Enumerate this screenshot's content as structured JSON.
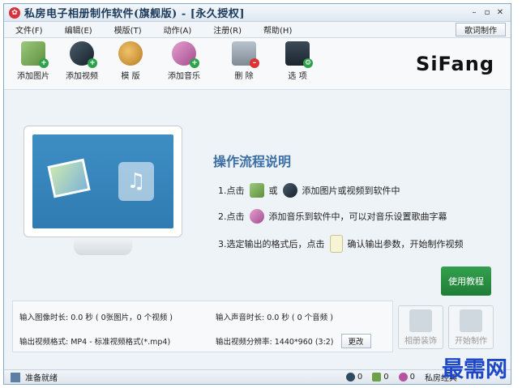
{
  "window": {
    "title": "私房电子相册制作软件(旗舰版) - [永久授权]",
    "controls": [
      "–",
      "▫",
      "✕"
    ]
  },
  "menu": {
    "items": [
      "文件(F)",
      "编辑(E)",
      "模版(T)",
      "动作(A)",
      "注册(R)",
      "帮助(H)"
    ],
    "lyric_button": "歌词制作"
  },
  "toolbar": {
    "items": [
      {
        "label": "添加图片",
        "icon": "add-picture-icon"
      },
      {
        "label": "添加视频",
        "icon": "add-video-icon"
      },
      {
        "label": "模 版",
        "icon": "template-palette-icon"
      },
      {
        "label": "添加音乐",
        "icon": "add-music-icon"
      },
      {
        "label": "删 除",
        "icon": "delete-trash-icon"
      },
      {
        "label": "选 项",
        "icon": "options-icon"
      }
    ],
    "logo": "SiFang"
  },
  "main": {
    "flow_title": "操作流程说明",
    "step1_prefix": "1.点击",
    "step1_or": "或",
    "step1_suffix": "添加图片或视频到软件中",
    "step2_prefix": "2.点击",
    "step2_suffix": "添加音乐到软件中，可以对音乐设置歌曲字幕",
    "step3_prefix": "3.选定输出的格式后，点击",
    "step3_suffix": "确认输出参数，开始制作视频",
    "tutorial_button": "使用教程"
  },
  "info": {
    "image_duration_label": "输入图像时长:",
    "image_duration_value": "0.0 秒 ( 0张图片，0 个视频 )",
    "audio_duration_label": "输入声音时长:",
    "audio_duration_value": "0.0 秒 ( 0 个音频 )",
    "output_format_label": "输出视频格式:",
    "output_format_value": "MP4 - 标准视频格式(*.mp4)",
    "resolution_label": "输出视频分辨率:",
    "resolution_value": "1440*960 (3:2)",
    "change_button": "更改"
  },
  "actions": {
    "decorate_label": "相册装饰",
    "start_label": "开始制作"
  },
  "status": {
    "text": "准备就绪",
    "video_count": "0",
    "image_count": "0",
    "music_count": "0",
    "brand": "私房经典"
  },
  "watermark": "最需网",
  "colors": {
    "accent": "#3a6ea5",
    "green_button": "#2a9145",
    "watermark": "#1e47c8"
  }
}
